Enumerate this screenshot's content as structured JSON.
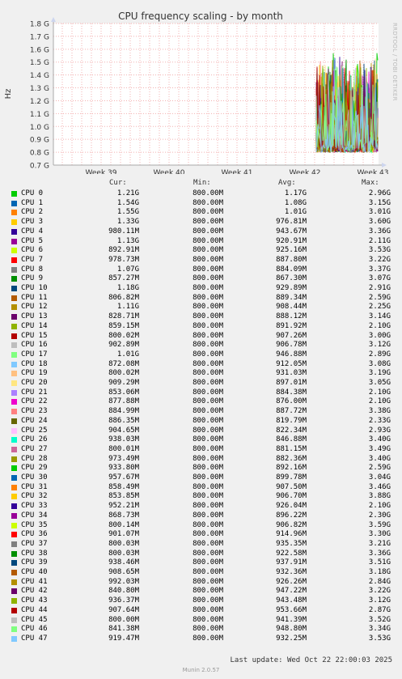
{
  "chart_data": {
    "type": "line",
    "title": "CPU frequency scaling - by month",
    "ylabel": "Hz",
    "yticks": [
      "0.7 G",
      "0.8 G",
      "0.9 G",
      "1.0 G",
      "1.1 G",
      "1.2 G",
      "1.3 G",
      "1.4 G",
      "1.5 G",
      "1.6 G",
      "1.7 G",
      "1.8 G"
    ],
    "ylim": [
      0.7,
      1.8
    ],
    "xticks": [
      "Week 39",
      "Week 40",
      "Week 41",
      "Week 42",
      "Week 43"
    ],
    "grid": true,
    "watermark": "RRDTOOL / TOBI OETIKER",
    "data_note": "Data present only from late Week 42 to Week 43; values oscillate between 0.8 G and about 1.56 G",
    "legend_headers": {
      "cur": "Cur:",
      "min": "Min:",
      "avg": "Avg:",
      "max": "Max:"
    },
    "series": [
      {
        "name": "CPU 0",
        "color": "#00cc00",
        "cur": "1.21G",
        "min": "800.00M",
        "avg": "1.17G",
        "max": "2.96G"
      },
      {
        "name": "CPU 1",
        "color": "#0066b3",
        "cur": "1.54G",
        "min": "800.00M",
        "avg": "1.08G",
        "max": "3.15G"
      },
      {
        "name": "CPU 2",
        "color": "#ff8000",
        "cur": "1.55G",
        "min": "800.00M",
        "avg": "1.01G",
        "max": "3.01G"
      },
      {
        "name": "CPU 3",
        "color": "#ffcc00",
        "cur": "1.33G",
        "min": "800.00M",
        "avg": "976.81M",
        "max": "3.60G"
      },
      {
        "name": "CPU 4",
        "color": "#330099",
        "cur": "980.11M",
        "min": "800.00M",
        "avg": "943.67M",
        "max": "3.36G"
      },
      {
        "name": "CPU 5",
        "color": "#990099",
        "cur": "1.13G",
        "min": "800.00M",
        "avg": "920.91M",
        "max": "2.11G"
      },
      {
        "name": "CPU 6",
        "color": "#ccff00",
        "cur": "892.91M",
        "min": "800.00M",
        "avg": "925.16M",
        "max": "3.53G"
      },
      {
        "name": "CPU 7",
        "color": "#ff0000",
        "cur": "978.73M",
        "min": "800.00M",
        "avg": "887.80M",
        "max": "3.22G"
      },
      {
        "name": "CPU 8",
        "color": "#808080",
        "cur": "1.07G",
        "min": "800.00M",
        "avg": "884.09M",
        "max": "3.37G"
      },
      {
        "name": "CPU 9",
        "color": "#008f00",
        "cur": "857.27M",
        "min": "800.00M",
        "avg": "867.30M",
        "max": "3.07G"
      },
      {
        "name": "CPU 10",
        "color": "#00487d",
        "cur": "1.18G",
        "min": "800.00M",
        "avg": "929.89M",
        "max": "2.91G"
      },
      {
        "name": "CPU 11",
        "color": "#b35a00",
        "cur": "806.82M",
        "min": "800.00M",
        "avg": "889.34M",
        "max": "2.59G"
      },
      {
        "name": "CPU 12",
        "color": "#b38f00",
        "cur": "1.11G",
        "min": "800.00M",
        "avg": "908.44M",
        "max": "2.25G"
      },
      {
        "name": "CPU 13",
        "color": "#6b006b",
        "cur": "828.71M",
        "min": "800.00M",
        "avg": "888.12M",
        "max": "3.14G"
      },
      {
        "name": "CPU 14",
        "color": "#8fb300",
        "cur": "859.15M",
        "min": "800.00M",
        "avg": "891.92M",
        "max": "2.10G"
      },
      {
        "name": "CPU 15",
        "color": "#b30000",
        "cur": "800.02M",
        "min": "800.00M",
        "avg": "907.26M",
        "max": "3.00G"
      },
      {
        "name": "CPU 16",
        "color": "#bebebe",
        "cur": "902.89M",
        "min": "800.00M",
        "avg": "906.78M",
        "max": "3.12G"
      },
      {
        "name": "CPU 17",
        "color": "#80ff80",
        "cur": "1.01G",
        "min": "800.00M",
        "avg": "946.88M",
        "max": "2.89G"
      },
      {
        "name": "CPU 18",
        "color": "#80c9ff",
        "cur": "872.08M",
        "min": "800.00M",
        "avg": "912.05M",
        "max": "3.08G"
      },
      {
        "name": "CPU 19",
        "color": "#ffc080",
        "cur": "800.02M",
        "min": "800.00M",
        "avg": "931.03M",
        "max": "3.19G"
      },
      {
        "name": "CPU 20",
        "color": "#ffe680",
        "cur": "909.29M",
        "min": "800.00M",
        "avg": "897.01M",
        "max": "3.05G"
      },
      {
        "name": "CPU 21",
        "color": "#aa80ff",
        "cur": "853.06M",
        "min": "800.00M",
        "avg": "884.38M",
        "max": "2.10G"
      },
      {
        "name": "CPU 22",
        "color": "#ee00cc",
        "cur": "877.88M",
        "min": "800.00M",
        "avg": "876.00M",
        "max": "2.10G"
      },
      {
        "name": "CPU 23",
        "color": "#ff8080",
        "cur": "884.99M",
        "min": "800.00M",
        "avg": "887.72M",
        "max": "3.38G"
      },
      {
        "name": "CPU 24",
        "color": "#666600",
        "cur": "886.35M",
        "min": "800.00M",
        "avg": "819.79M",
        "max": "2.33G"
      },
      {
        "name": "CPU 25",
        "color": "#ffbfff",
        "cur": "904.65M",
        "min": "800.00M",
        "avg": "822.34M",
        "max": "2.93G"
      },
      {
        "name": "CPU 26",
        "color": "#00ffcc",
        "cur": "938.03M",
        "min": "800.00M",
        "avg": "846.88M",
        "max": "3.40G"
      },
      {
        "name": "CPU 27",
        "color": "#cc6699",
        "cur": "800.01M",
        "min": "800.00M",
        "avg": "881.15M",
        "max": "3.49G"
      },
      {
        "name": "CPU 28",
        "color": "#999900",
        "cur": "973.49M",
        "min": "800.00M",
        "avg": "882.36M",
        "max": "3.40G"
      },
      {
        "name": "CPU 29",
        "color": "#00cc00",
        "cur": "933.80M",
        "min": "800.00M",
        "avg": "892.16M",
        "max": "2.59G"
      },
      {
        "name": "CPU 30",
        "color": "#0066b3",
        "cur": "957.67M",
        "min": "800.00M",
        "avg": "899.78M",
        "max": "3.04G"
      },
      {
        "name": "CPU 31",
        "color": "#ff8000",
        "cur": "858.49M",
        "min": "800.00M",
        "avg": "907.50M",
        "max": "3.46G"
      },
      {
        "name": "CPU 32",
        "color": "#ffcc00",
        "cur": "853.85M",
        "min": "800.00M",
        "avg": "906.70M",
        "max": "3.88G"
      },
      {
        "name": "CPU 33",
        "color": "#330099",
        "cur": "952.21M",
        "min": "800.00M",
        "avg": "926.04M",
        "max": "2.10G"
      },
      {
        "name": "CPU 34",
        "color": "#990099",
        "cur": "868.73M",
        "min": "800.00M",
        "avg": "896.22M",
        "max": "2.30G"
      },
      {
        "name": "CPU 35",
        "color": "#ccff00",
        "cur": "800.14M",
        "min": "800.00M",
        "avg": "906.82M",
        "max": "3.59G"
      },
      {
        "name": "CPU 36",
        "color": "#ff0000",
        "cur": "901.07M",
        "min": "800.00M",
        "avg": "914.96M",
        "max": "3.30G"
      },
      {
        "name": "CPU 37",
        "color": "#808080",
        "cur": "800.03M",
        "min": "800.00M",
        "avg": "935.35M",
        "max": "3.21G"
      },
      {
        "name": "CPU 38",
        "color": "#008f00",
        "cur": "800.03M",
        "min": "800.00M",
        "avg": "922.58M",
        "max": "3.36G"
      },
      {
        "name": "CPU 39",
        "color": "#00487d",
        "cur": "938.46M",
        "min": "800.00M",
        "avg": "937.91M",
        "max": "3.51G"
      },
      {
        "name": "CPU 40",
        "color": "#b35a00",
        "cur": "908.65M",
        "min": "800.00M",
        "avg": "932.36M",
        "max": "3.18G"
      },
      {
        "name": "CPU 41",
        "color": "#b38f00",
        "cur": "992.03M",
        "min": "800.00M",
        "avg": "926.26M",
        "max": "2.84G"
      },
      {
        "name": "CPU 42",
        "color": "#6b006b",
        "cur": "840.80M",
        "min": "800.00M",
        "avg": "947.22M",
        "max": "3.22G"
      },
      {
        "name": "CPU 43",
        "color": "#8fb300",
        "cur": "936.37M",
        "min": "800.00M",
        "avg": "943.48M",
        "max": "3.12G"
      },
      {
        "name": "CPU 44",
        "color": "#b30000",
        "cur": "907.64M",
        "min": "800.00M",
        "avg": "953.66M",
        "max": "2.87G"
      },
      {
        "name": "CPU 45",
        "color": "#bebebe",
        "cur": "800.00M",
        "min": "800.00M",
        "avg": "941.39M",
        "max": "3.52G"
      },
      {
        "name": "CPU 46",
        "color": "#80ff80",
        "cur": "841.38M",
        "min": "800.00M",
        "avg": "948.80M",
        "max": "3.34G"
      },
      {
        "name": "CPU 47",
        "color": "#80c9ff",
        "cur": "919.47M",
        "min": "800.00M",
        "avg": "932.25M",
        "max": "3.53G"
      }
    ]
  },
  "footer": {
    "last_update": "Last update: Wed Oct 22 22:00:03 2025",
    "munin": "Munin 2.0.57"
  }
}
